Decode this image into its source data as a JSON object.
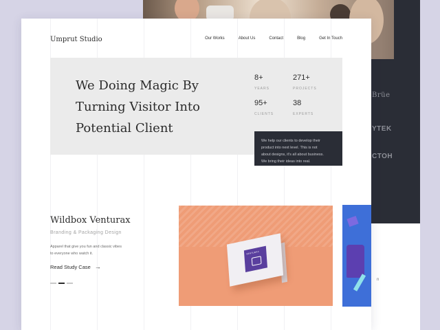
{
  "brand": "Umprut Studio",
  "nav": [
    "Our Works",
    "About Us",
    "Contact",
    "Blog",
    "Get In Touch"
  ],
  "hero": {
    "headline_lines": [
      "We Doing Magic By",
      "Turning Visitor Into",
      "Potential Client"
    ],
    "stats": [
      {
        "value": "8+",
        "label": "YEARS"
      },
      {
        "value": "271+",
        "label": "PROJECTS"
      },
      {
        "value": "95+",
        "label": "CLIENTS"
      },
      {
        "value": "38",
        "label": "EXPERTS"
      }
    ],
    "callout_lines": [
      "We help our clients to develop their",
      "product into next level. This is not",
      "about designs, it's all about business.",
      "We bring their ideas into real."
    ]
  },
  "project": {
    "title": "Wildbox Venturax",
    "subtitle": "Branding & Packaging Design",
    "description_lines": [
      "Apparel that give you fun and classic vibes",
      "to everyone who watch it."
    ],
    "cta": "Read Study Case",
    "box_label": "VENTURAX"
  },
  "back_page": {
    "logos": [
      "Brüe",
      "YTEK",
      "CTOH"
    ],
    "partial_text": "n"
  },
  "slider": {
    "count": 3,
    "active": 2
  },
  "colors": {
    "background": "#d6d4e6",
    "dark_panel": "#2a2d36",
    "hero_bg": "#ebebeb",
    "showcase_orange": "#ef9c76",
    "box_purple": "#5a3f9e",
    "thumb_blue": "#3e6fd8"
  }
}
